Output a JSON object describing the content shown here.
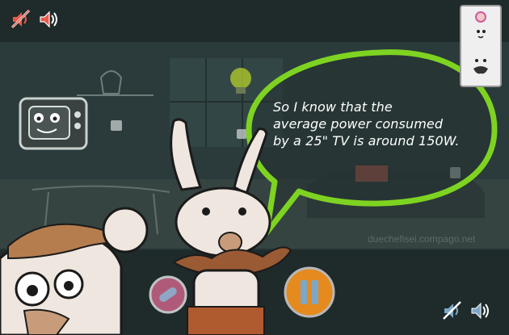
{
  "dialogue": {
    "line1": "So I know that the",
    "line2": "average power consumed",
    "line3": "by a 25\" TV is around 150W."
  },
  "watermark": "duechefisei.compago.net",
  "controls": {
    "top_mute_icon": "muted-speaker-icon",
    "top_sound_icon": "speaker-icon",
    "bottom_mute_icon": "muted-speaker-icon",
    "bottom_sound_icon": "speaker-icon",
    "pause_icon": "pause-icon"
  },
  "colors": {
    "bubble_border": "#7ed321",
    "pause_fill": "#e58a1f",
    "accent_red": "#d0382b"
  }
}
